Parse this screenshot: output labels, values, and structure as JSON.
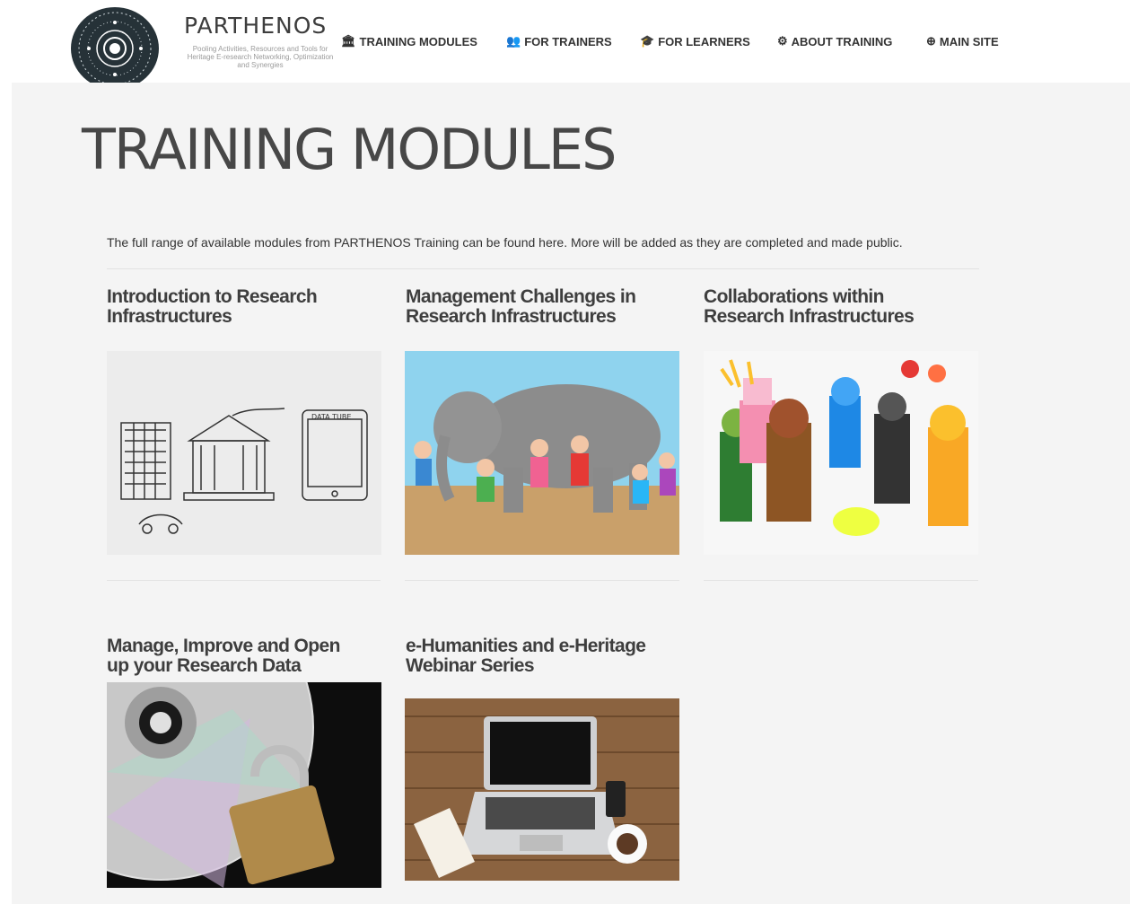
{
  "brand": {
    "name": "PARTHENOS",
    "tagline": "Pooling Activities, Resources and Tools for Heritage E-research Networking, Optimization and Synergies"
  },
  "nav": [
    {
      "label": "TRAINING MODULES",
      "icon": "bank-icon"
    },
    {
      "label": "FOR TRAINERS",
      "icon": "users-icon"
    },
    {
      "label": "FOR LEARNERS",
      "icon": "graduation-cap-icon"
    },
    {
      "label": "ABOUT TRAINING",
      "icon": "gears-icon"
    },
    {
      "label": "MAIN SITE",
      "icon": "arrow-circle-icon"
    }
  ],
  "page": {
    "title": "TRAINING MODULES",
    "intro": "The full range of available modules from PARTHENOS Training can be found here.  More will be added as they are completed and made public."
  },
  "modules": [
    {
      "title_line1": "Introduction to Research",
      "title_line2": "Infrastructures",
      "image": "sketch of buildings, tablet and car"
    },
    {
      "title_line1": "Management Challenges in",
      "title_line2": "Research Infrastructures",
      "image": "blind men and the elephant cartoon"
    },
    {
      "title_line1": "Collaborations within",
      "title_line2": "Research Infrastructures",
      "image": "lego minifigures group"
    },
    {
      "title_line1": "Manage, Improve and Open",
      "title_line2": "up your Research Data",
      "image": "cd with padlock"
    },
    {
      "title_line1": "e-Humanities and e-Heritage",
      "title_line2": "Webinar Series",
      "image": "laptop on wooden desk"
    }
  ]
}
